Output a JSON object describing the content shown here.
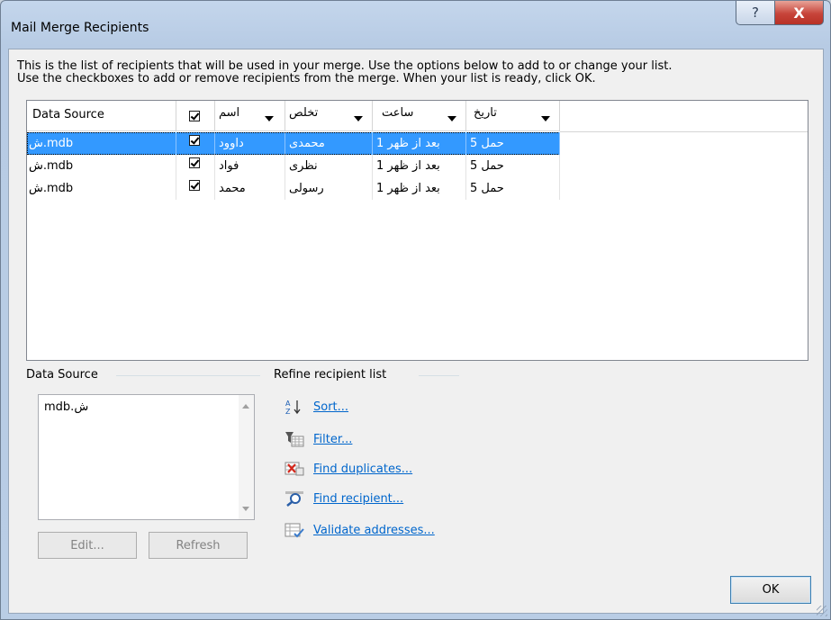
{
  "window": {
    "title": "Mail Merge Recipients",
    "help_label": "?",
    "close_label": "X"
  },
  "intro": {
    "line1": "This is the list of recipients that will be used in your merge.  Use the options below to add to or change your list.",
    "line2": "Use the checkboxes to add or remove recipients from the merge.  When your list is ready, click OK."
  },
  "grid": {
    "columns": [
      "Data Source",
      "",
      "اسم",
      "تخلص",
      "ساعت",
      "تاریخ"
    ],
    "rows": [
      {
        "source": "ش.mdb",
        "checked": true,
        "name": "داوود",
        "surname": "محمدی",
        "time": "بعد از ظهر 1",
        "date": "حمل 5",
        "selected": true
      },
      {
        "source": "ش.mdb",
        "checked": true,
        "name": "فواد",
        "surname": "نظری",
        "time": "بعد از ظهر 1",
        "date": "حمل 5",
        "selected": false
      },
      {
        "source": "ش.mdb",
        "checked": true,
        "name": "محمد",
        "surname": "رسولی",
        "time": "بعد از ظهر 1",
        "date": "حمل 5",
        "selected": false
      }
    ]
  },
  "data_source": {
    "label": "Data Source",
    "items": [
      "mdb.ش"
    ],
    "edit_label": "Edit...",
    "refresh_label": "Refresh"
  },
  "refine": {
    "label": "Refine recipient list",
    "links": [
      "Sort...",
      "Filter...",
      "Find duplicates...",
      "Find recipient...",
      "Validate addresses..."
    ]
  },
  "ok_label": "OK"
}
